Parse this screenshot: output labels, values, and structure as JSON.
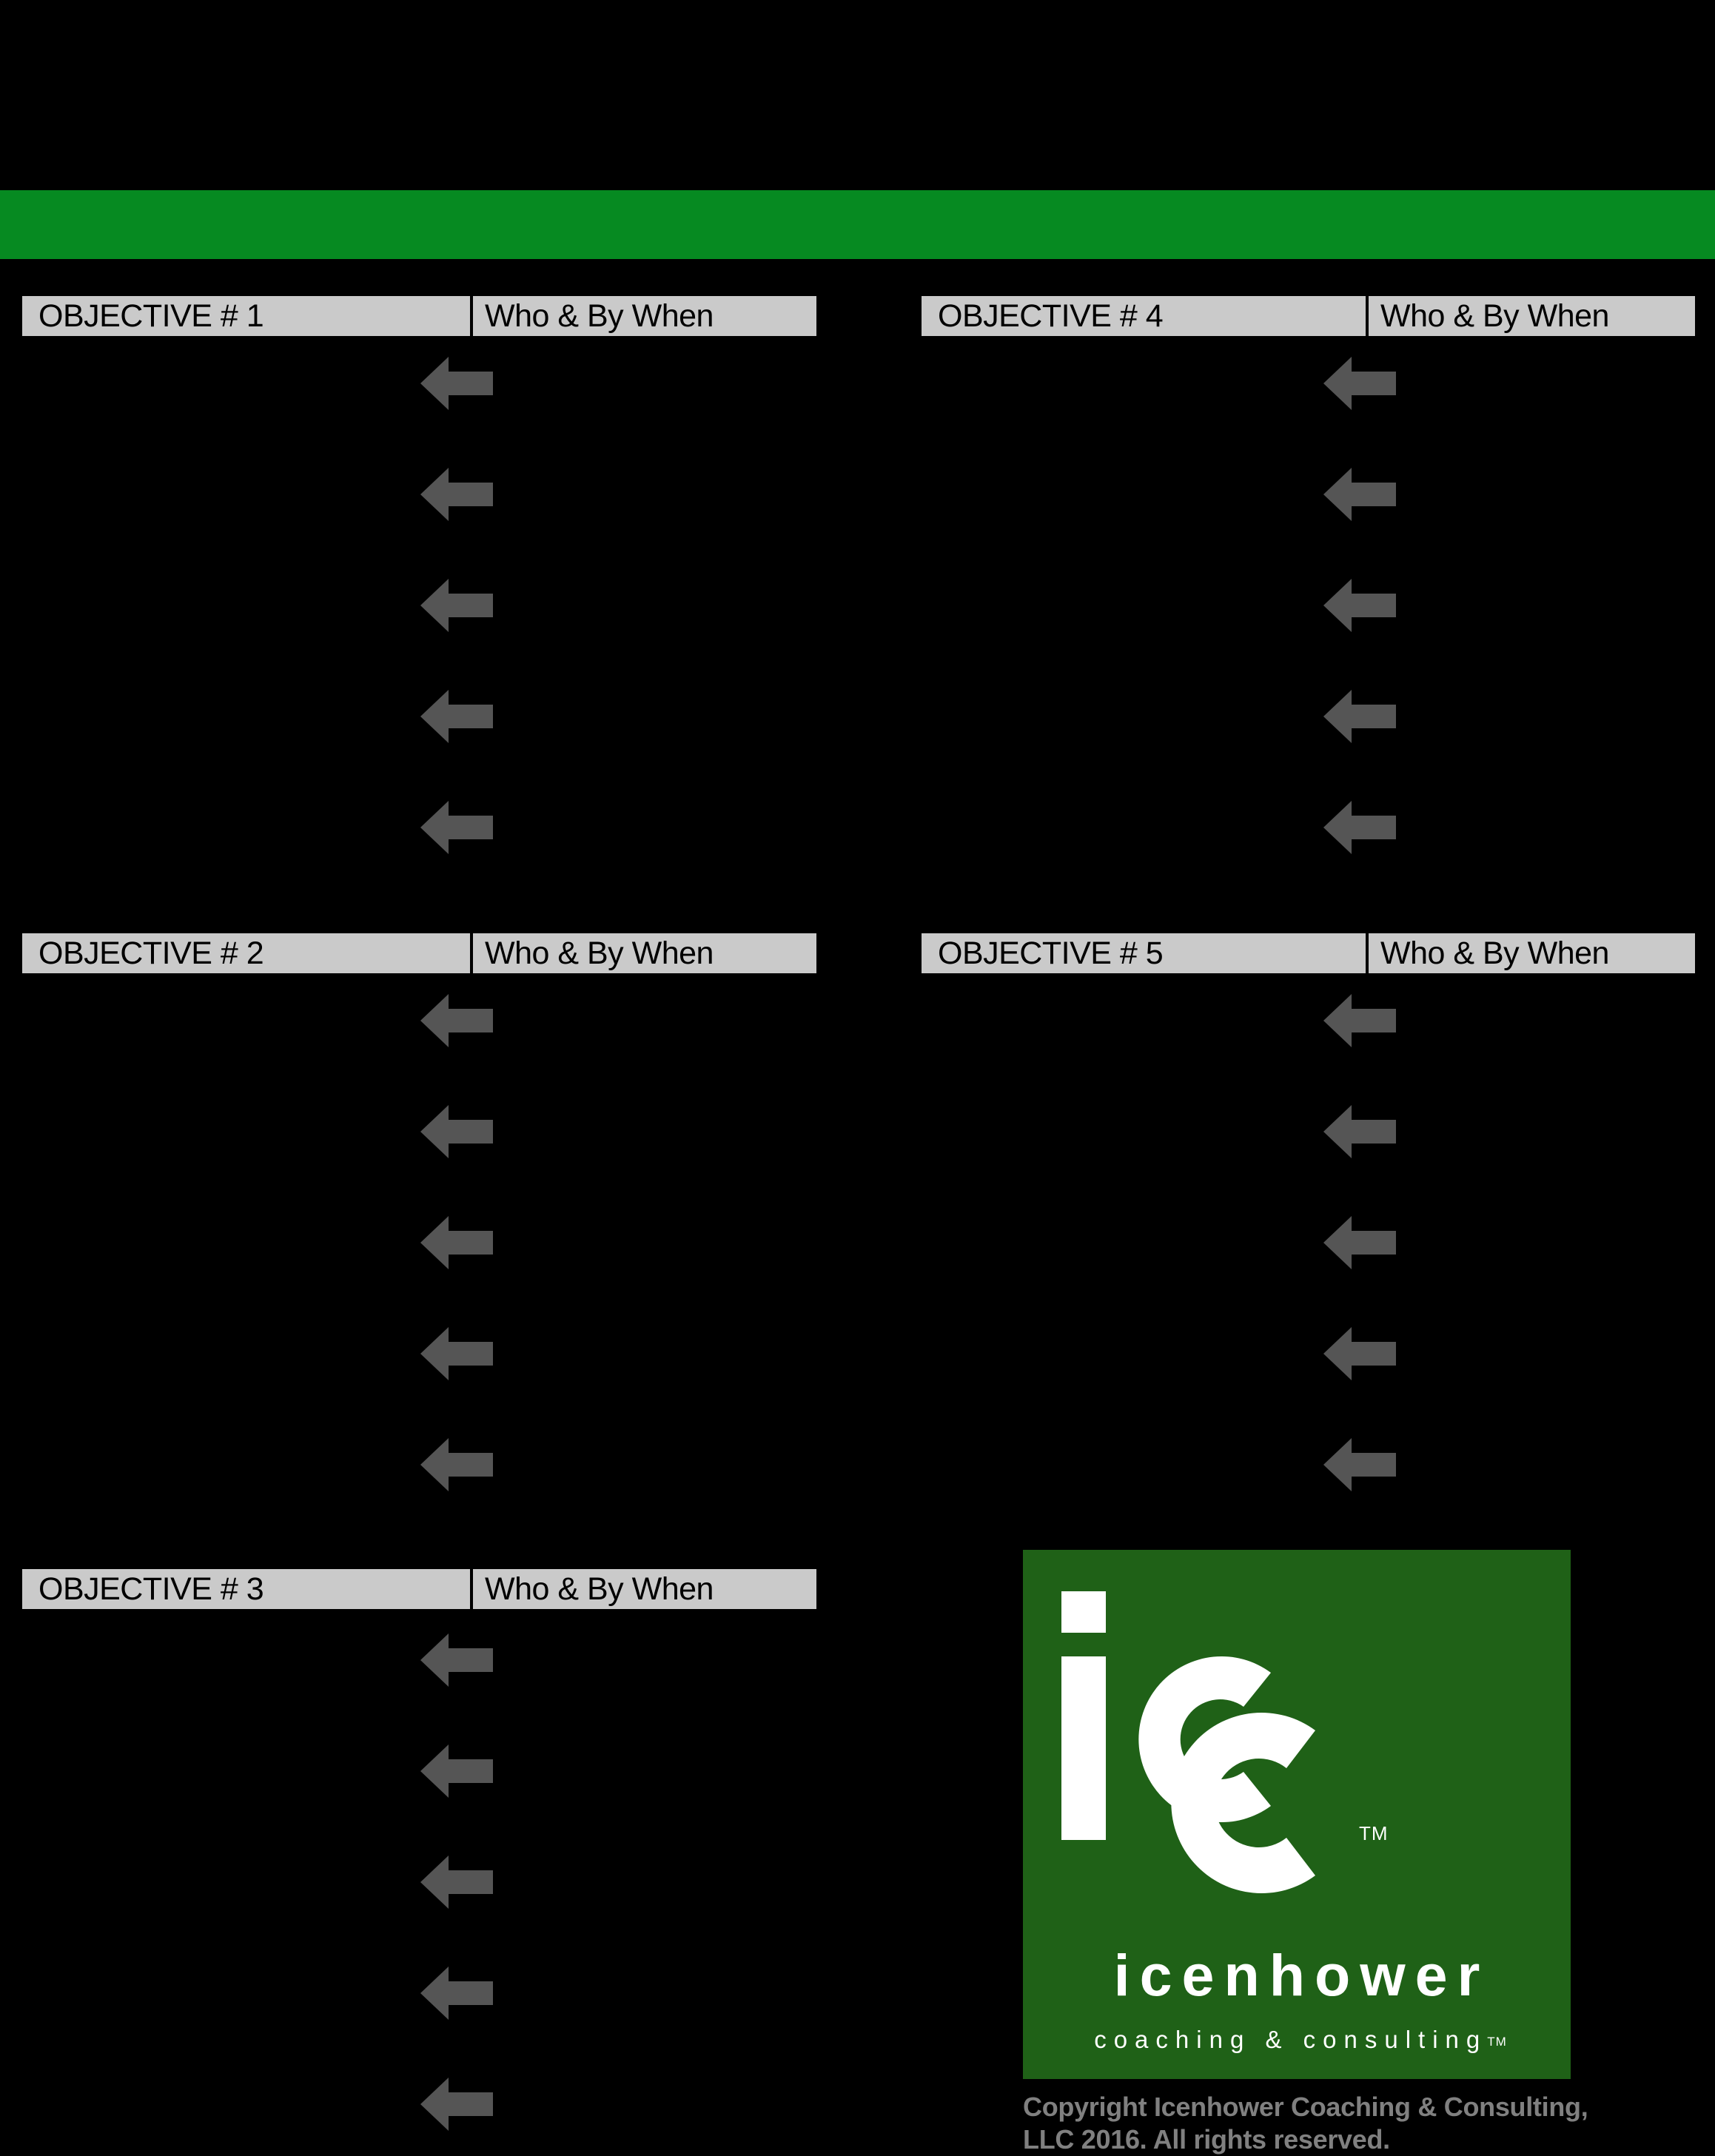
{
  "page": {
    "background_color": "#000000",
    "banner_color": "#068A21",
    "header_bar_color": "#CACACA",
    "arrow_color": "#555555",
    "logo_green": "#1F6117",
    "copyright_color": "#808080"
  },
  "banner": {
    "label": ""
  },
  "objectives": [
    {
      "id": "objective-1",
      "title": "OBJECTIVE # 1",
      "who_label": "Who & By When",
      "arrows": [
        "arrow-1",
        "arrow-2",
        "arrow-3",
        "arrow-4",
        "arrow-5"
      ]
    },
    {
      "id": "objective-2",
      "title": "OBJECTIVE # 2",
      "who_label": "Who & By When",
      "arrows": [
        "arrow-1",
        "arrow-2",
        "arrow-3",
        "arrow-4",
        "arrow-5"
      ]
    },
    {
      "id": "objective-3",
      "title": "OBJECTIVE # 3",
      "who_label": "Who & By When",
      "arrows": [
        "arrow-1",
        "arrow-2",
        "arrow-3",
        "arrow-4",
        "arrow-5"
      ]
    },
    {
      "id": "objective-4",
      "title": "OBJECTIVE # 4",
      "who_label": "Who & By When",
      "arrows": [
        "arrow-1",
        "arrow-2",
        "arrow-3",
        "arrow-4",
        "arrow-5"
      ]
    },
    {
      "id": "objective-5",
      "title": "OBJECTIVE # 5",
      "who_label": "Who & By When",
      "arrows": [
        "arrow-1",
        "arrow-2",
        "arrow-3",
        "arrow-4",
        "arrow-5"
      ]
    }
  ],
  "logo": {
    "monogram": "icc",
    "wordmark": "icenhower",
    "tagline": "coaching & consulting",
    "tagline_tm": "TM",
    "mark_tm": "TM"
  },
  "copyright": {
    "line1": "Copyright Icenhower Coaching & Consulting,",
    "line2": "LLC 2016. All rights reserved."
  }
}
